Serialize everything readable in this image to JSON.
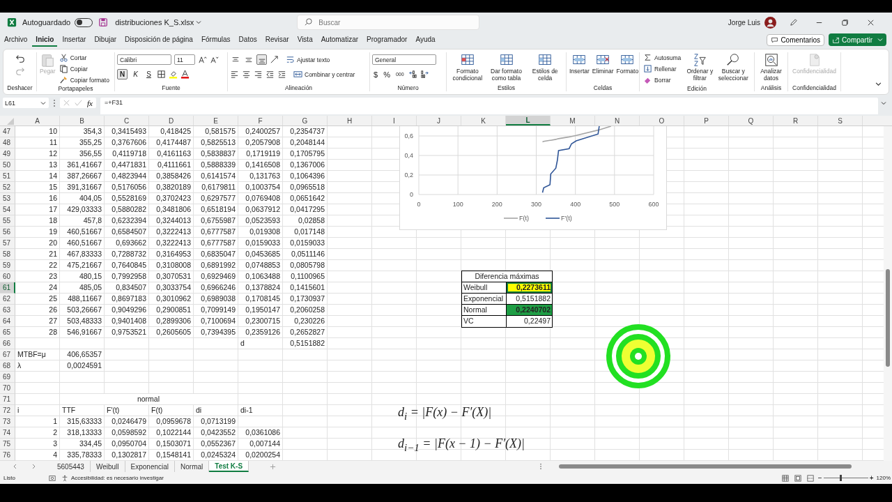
{
  "title_bar": {
    "autosave_label": "Autoguardado",
    "autosave_on": false,
    "file_name": "distribuciones K_S.xlsx",
    "search": {
      "placeholder": "Buscar"
    },
    "user_name": "Jorge Luis"
  },
  "menu_tabs": [
    {
      "label": "Archivo",
      "selected": false
    },
    {
      "label": "Inicio",
      "selected": true
    },
    {
      "label": "Insertar",
      "selected": false
    },
    {
      "label": "Dibujar",
      "selected": false
    },
    {
      "label": "Disposición de página",
      "selected": false
    },
    {
      "label": "Fórmulas",
      "selected": false
    },
    {
      "label": "Datos",
      "selected": false
    },
    {
      "label": "Revisar",
      "selected": false
    },
    {
      "label": "Vista",
      "selected": false
    },
    {
      "label": "Automatizar",
      "selected": false
    },
    {
      "label": "Programador",
      "selected": false
    },
    {
      "label": "Ayuda",
      "selected": false
    }
  ],
  "header_buttons": {
    "comments": "Comentarios",
    "share": "Compartir"
  },
  "ribbon": {
    "undo": {
      "label": "Deshacer"
    },
    "clipboard": {
      "label": "Portapapeles",
      "paste": {
        "text": "Pegar",
        "disabled": true
      },
      "actions": [
        "Cortar",
        "Copiar",
        "Copiar formato"
      ]
    },
    "font": {
      "label": "Fuente",
      "family": "Calibri",
      "size": "11",
      "bold": {
        "text": "N",
        "on": true
      },
      "italic": {
        "text": "K",
        "on": false
      },
      "underline": {
        "text": "S",
        "on": false
      }
    },
    "alignment": {
      "label": "Alineación",
      "vertical_align": [
        {
          "selected": false
        },
        {
          "selected": false
        },
        {
          "selected": true
        }
      ],
      "wrap": "Ajustar texto",
      "merge": "Combinar y centrar"
    },
    "number": {
      "label": "Número",
      "format": "General",
      "currency": "$",
      "percent": "%",
      "thousands": "000"
    },
    "styles": {
      "label": "Estilos",
      "buttons": [
        "Formato condicional",
        "Dar formato como tabla",
        "Estilos de celda"
      ]
    },
    "cells": {
      "label": "Celdas",
      "buttons": [
        "Insertar",
        "Eliminar",
        "Formato"
      ]
    },
    "editing": {
      "label": "Edición",
      "small": [
        "Autosuma",
        "Rellenar",
        "Borrar"
      ],
      "large": [
        "Ordenar y filtrar",
        "Buscar y seleccionar"
      ]
    },
    "analysis": {
      "label": "Análisis",
      "button": "Analizar datos"
    },
    "sensitivity": {
      "label": "Confidencialidad",
      "button": {
        "text": "Confidencialidad",
        "disabled": true
      }
    }
  },
  "formula_bar": {
    "name_box": "L61",
    "fx": "fx",
    "formula": "=+F31"
  },
  "columns": [
    {
      "label": "A",
      "selected": false
    },
    {
      "label": "B",
      "selected": false
    },
    {
      "label": "C",
      "selected": false
    },
    {
      "label": "D",
      "selected": false
    },
    {
      "label": "E",
      "selected": false
    },
    {
      "label": "F",
      "selected": false
    },
    {
      "label": "G",
      "selected": false
    },
    {
      "label": "H",
      "selected": false
    },
    {
      "label": "I",
      "selected": false
    },
    {
      "label": "J",
      "selected": false
    },
    {
      "label": "K",
      "selected": false
    },
    {
      "label": "L",
      "selected": true
    },
    {
      "label": "M",
      "selected": false
    },
    {
      "label": "N",
      "selected": false
    },
    {
      "label": "O",
      "selected": false
    },
    {
      "label": "P",
      "selected": false
    },
    {
      "label": "Q",
      "selected": false
    },
    {
      "label": "R",
      "selected": false
    },
    {
      "label": "S",
      "selected": false
    }
  ],
  "rows": [
    {
      "number": "47",
      "selected": false,
      "cells": [
        "10",
        "354,3",
        "0,3415493",
        "0,418425",
        "0,581575",
        "0,2400257",
        "0,2354737"
      ]
    },
    {
      "number": "48",
      "selected": false,
      "cells": [
        "11",
        "355,25",
        "0,3767606",
        "0,4174487",
        "0,5825513",
        "0,2057908",
        "0,2048144"
      ]
    },
    {
      "number": "49",
      "selected": false,
      "cells": [
        "12",
        "356,55",
        "0,4119718",
        "0,4161163",
        "0,5838837",
        "0,1719119",
        "0,1705795"
      ]
    },
    {
      "number": "50",
      "selected": false,
      "cells": [
        "13",
        "361,41667",
        "0,4471831",
        "0,4111661",
        "0,5888339",
        "0,1416508",
        "0,1367006"
      ]
    },
    {
      "number": "51",
      "selected": false,
      "cells": [
        "14",
        "387,26667",
        "0,4823944",
        "0,3858426",
        "0,6141574",
        "0,131763",
        "0,1064396"
      ]
    },
    {
      "number": "52",
      "selected": false,
      "cells": [
        "15",
        "391,31667",
        "0,5176056",
        "0,3820189",
        "0,6179811",
        "0,1003754",
        "0,0965518"
      ]
    },
    {
      "number": "53",
      "selected": false,
      "cells": [
        "16",
        "404,05",
        "0,5528169",
        "0,3702423",
        "0,6297577",
        "0,0769408",
        "0,0651642"
      ]
    },
    {
      "number": "54",
      "selected": false,
      "cells": [
        "17",
        "429,03333",
        "0,5880282",
        "0,3481806",
        "0,6518194",
        "0,0637912",
        "0,0417295"
      ]
    },
    {
      "number": "55",
      "selected": false,
      "cells": [
        "18",
        "457,8",
        "0,6232394",
        "0,3244013",
        "0,6755987",
        "0,0523593",
        "0,02858"
      ]
    },
    {
      "number": "56",
      "selected": false,
      "cells": [
        "19",
        "460,51667",
        "0,6584507",
        "0,3222413",
        "0,6777587",
        "0,019308",
        "0,017148"
      ]
    },
    {
      "number": "57",
      "selected": false,
      "cells": [
        "20",
        "460,51667",
        "0,693662",
        "0,3222413",
        "0,6777587",
        "0,0159033",
        "0,0159033"
      ]
    },
    {
      "number": "58",
      "selected": false,
      "cells": [
        "21",
        "467,83333",
        "0,7288732",
        "0,3164953",
        "0,6835047",
        "0,0453685",
        "0,0511146"
      ]
    },
    {
      "number": "59",
      "selected": false,
      "cells": [
        "22",
        "475,21667",
        "0,7640845",
        "0,3108008",
        "0,6891992",
        "0,0748853",
        "0,0805798"
      ]
    },
    {
      "number": "60",
      "selected": false,
      "cells": [
        "23",
        "480,15",
        "0,7992958",
        "0,3070531",
        "0,6929469",
        "0,1063488",
        "0,1100965"
      ]
    },
    {
      "number": "61",
      "selected": true,
      "cells": [
        "24",
        "485,05",
        "0,834507",
        "0,3033754",
        "0,6966246",
        "0,1378824",
        "0,1415601"
      ]
    },
    {
      "number": "62",
      "selected": false,
      "cells": [
        "25",
        "488,11667",
        "0,8697183",
        "0,3010962",
        "0,6989038",
        "0,1708145",
        "0,1730937"
      ]
    },
    {
      "number": "63",
      "selected": false,
      "cells": [
        "26",
        "503,26667",
        "0,9049296",
        "0,2900851",
        "0,7099149",
        "0,1950147",
        "0,2060258"
      ]
    },
    {
      "number": "64",
      "selected": false,
      "cells": [
        "27",
        "503,48333",
        "0,9401408",
        "0,2899306",
        "0,7100694",
        "0,2300715",
        "0,230226"
      ]
    },
    {
      "number": "65",
      "selected": false,
      "cells": [
        "28",
        "546,91667",
        "0,9753521",
        "0,2605605",
        "0,7394395",
        "0,2359126",
        "0,2652827"
      ]
    },
    {
      "number": "66",
      "selected": false,
      "cells": [
        null,
        null,
        null,
        null,
        null,
        "d",
        "0,5151882"
      ]
    },
    {
      "number": "67",
      "selected": false,
      "cells": [
        "MTBF=μ",
        "406,65357"
      ]
    },
    {
      "number": "68",
      "selected": false,
      "cells": [
        "λ",
        "0,0024591"
      ]
    },
    {
      "number": "69",
      "selected": false,
      "cells": []
    },
    {
      "number": "70",
      "selected": false,
      "cells": []
    },
    {
      "number": "71",
      "selected": false,
      "title": "normal",
      "cells": []
    },
    {
      "number": "72",
      "selected": false,
      "cells": [
        "i",
        "TTF",
        "F'(t)",
        "F(t)",
        "di",
        "di-1"
      ]
    },
    {
      "number": "73",
      "selected": false,
      "cells": [
        "1",
        "315,63333",
        "0,0246479",
        "0,0959678",
        "0,0713199"
      ]
    },
    {
      "number": "74",
      "selected": false,
      "cells": [
        "2",
        "318,13333",
        "0,0598592",
        "0,1022144",
        "0,0423552",
        "0,0361086"
      ]
    },
    {
      "number": "75",
      "selected": false,
      "cells": [
        "3",
        "334,45",
        "0,0950704",
        "0,1503071",
        "0,0552367",
        "0,007144"
      ]
    },
    {
      "number": "76",
      "selected": false,
      "cells": [
        "4",
        "335,78333",
        "0,1302817",
        "0,1548141",
        "0,0245324",
        "0,0200254"
      ]
    }
  ],
  "chart": {
    "chart_data": {
      "type": "line",
      "x": [
        316,
        319,
        335,
        337,
        350,
        354,
        357,
        384,
        390,
        402,
        458,
        461,
        491
      ],
      "series": [
        {
          "name": "F(t)",
          "color": "#a5a5a5",
          "values": [
            0.54,
            0.545,
            0.555,
            0.556,
            0.565,
            0.57,
            0.572,
            0.59,
            0.595,
            0.605,
            0.66,
            0.662,
            0.7
          ]
        },
        {
          "name": "F'(t)",
          "color": "#2f5597",
          "values": [
            0.02,
            0.07,
            0.1,
            0.21,
            0.27,
            0.35,
            0.45,
            0.47,
            0.52,
            0.55,
            0.62,
            0.7,
            null
          ]
        }
      ],
      "grid": true,
      "legend": true,
      "xlim": [
        0,
        600
      ],
      "ylim": [
        0,
        0.7
      ],
      "xticks": [
        0,
        100,
        200,
        300,
        400,
        500,
        600
      ],
      "yticks": [
        {
          "value": 0,
          "label": "0"
        },
        {
          "value": 0.2,
          "label": "0,2"
        },
        {
          "value": 0.4,
          "label": "0,4"
        },
        {
          "value": 0.6,
          "label": "0,6"
        }
      ]
    }
  },
  "diff_table": {
    "title": "Diferencia máximas",
    "rows": [
      {
        "label": "Weibull",
        "value": "0,2273611",
        "color": "#ffff00",
        "bold": true,
        "selected": true
      },
      {
        "label": "Exponencial",
        "value": "0,5151882",
        "color": "#ffffff",
        "bold": false,
        "selected": false
      },
      {
        "label": "Normal",
        "value": "0,2240702",
        "color": "#1f9e45",
        "bold": true,
        "selected": false
      },
      {
        "label": "VC",
        "value": "0,22497",
        "color": "#ffffff",
        "bold": false,
        "selected": false
      }
    ]
  },
  "formulas": [
    "d$_{i}$ = |F(x) − F′(X)|",
    "d$_{i−1}$ = |F(x − 1) − F′(X)|"
  ],
  "sheet_tabs": [
    {
      "label": "5605443",
      "selected": false
    },
    {
      "label": "Weibull",
      "selected": false
    },
    {
      "label": "Exponencial",
      "selected": false
    },
    {
      "label": "Normal",
      "selected": false
    },
    {
      "label": "Test K-S",
      "selected": true
    }
  ],
  "status_bar": {
    "ready": "Listo",
    "accessibility": "Accesibilidad: es necesario investigar",
    "zoom": {
      "level": 0.36
    },
    "zoom_text": "120%",
    "zoom_out": "−",
    "zoom_in": "+"
  }
}
